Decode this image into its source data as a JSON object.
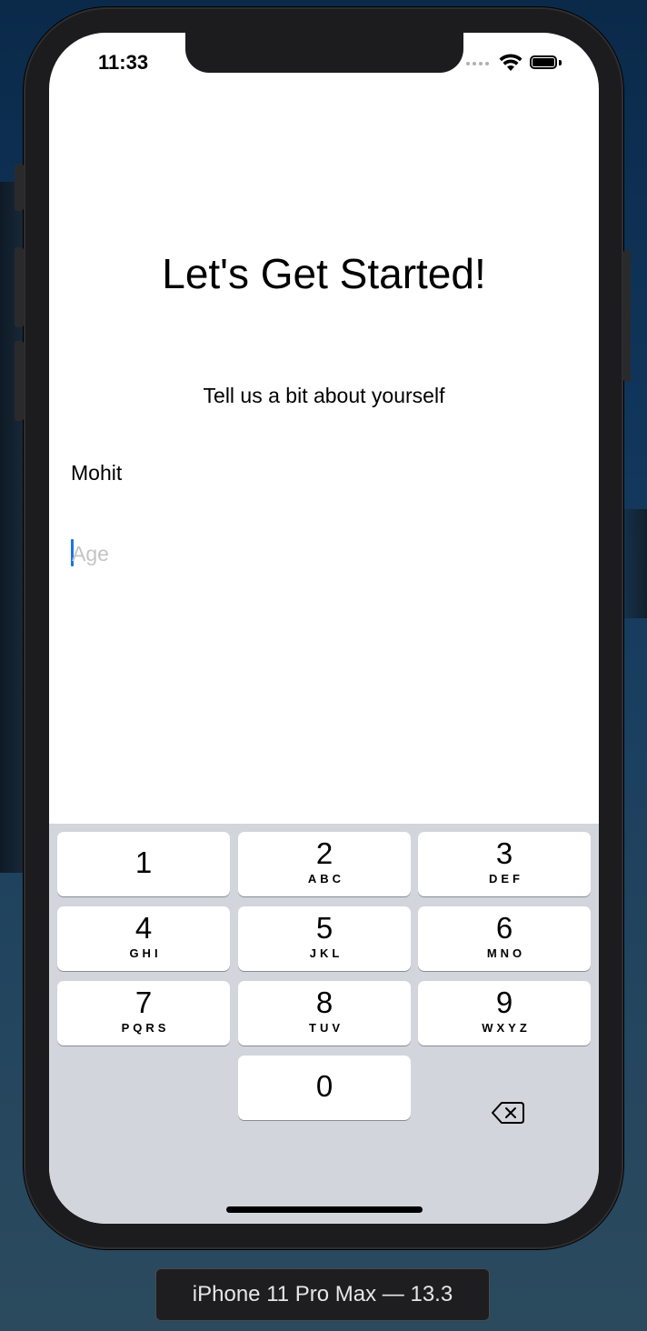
{
  "status_bar": {
    "time": "11:33"
  },
  "screen": {
    "title": "Let's Get Started!",
    "subtitle": "Tell us a bit about yourself",
    "name_field": {
      "value": "Mohit"
    },
    "age_field": {
      "value": "",
      "placeholder": "Age"
    }
  },
  "keyboard": {
    "keys": [
      {
        "digit": "1",
        "letters": ""
      },
      {
        "digit": "2",
        "letters": "ABC"
      },
      {
        "digit": "3",
        "letters": "DEF"
      },
      {
        "digit": "4",
        "letters": "GHI"
      },
      {
        "digit": "5",
        "letters": "JKL"
      },
      {
        "digit": "6",
        "letters": "MNO"
      },
      {
        "digit": "7",
        "letters": "PQRS"
      },
      {
        "digit": "8",
        "letters": "TUV"
      },
      {
        "digit": "9",
        "letters": "WXYZ"
      },
      {
        "digit": "0",
        "letters": ""
      }
    ],
    "delete_icon": "delete-backward-icon"
  },
  "device_label": "iPhone 11 Pro Max — 13.3",
  "colors": {
    "caret": "#1a73e8",
    "keyboard_bg": "#d2d5db",
    "placeholder": "#c4c4c6"
  }
}
